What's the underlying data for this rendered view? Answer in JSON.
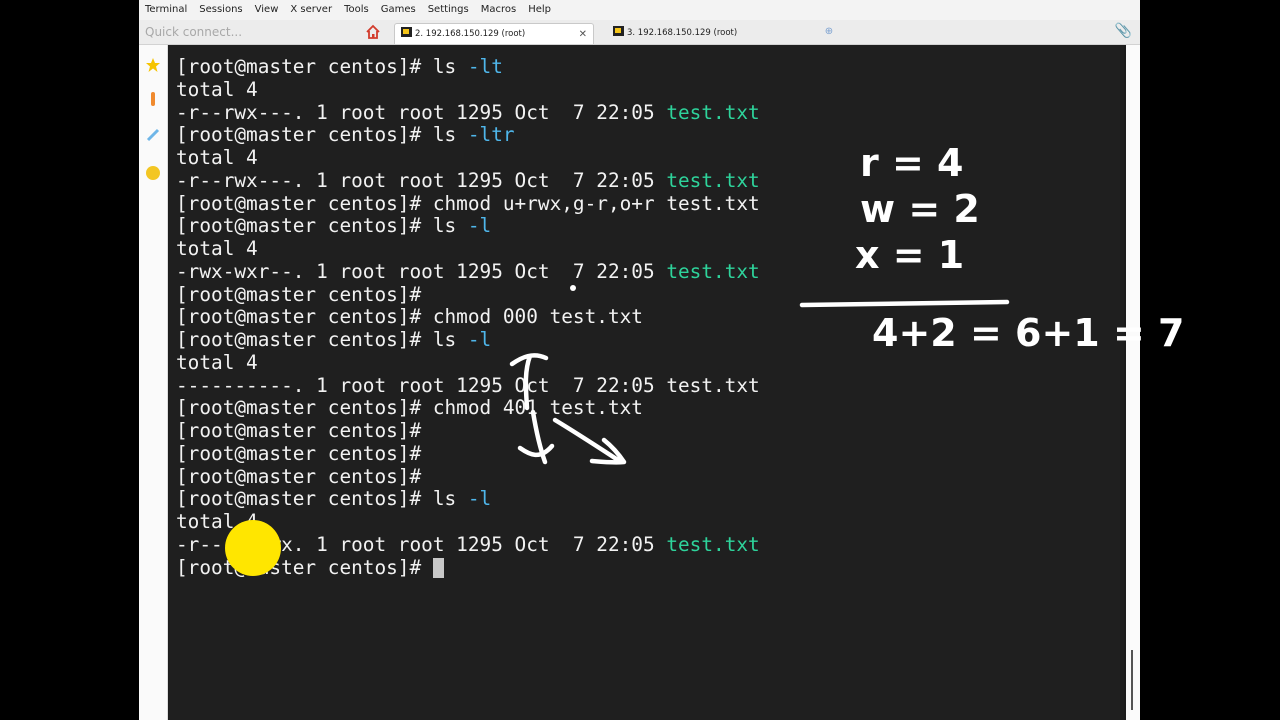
{
  "menu": [
    "Terminal",
    "Sessions",
    "View",
    "X server",
    "Tools",
    "Games",
    "Settings",
    "Macros",
    "Help"
  ],
  "quick_connect": {
    "placeholder": "Quick connect..."
  },
  "tabs": [
    {
      "label": "2. 192.168.150.129 (root)",
      "active": true
    },
    {
      "label": "3. 192.168.150.129 (root)",
      "active": false
    }
  ],
  "terminal": {
    "lines": [
      {
        "segments": [
          {
            "text": "[root@master centos]# ls "
          },
          {
            "text": "-lt",
            "cls": "opt"
          }
        ]
      },
      {
        "segments": [
          {
            "text": "total 4"
          }
        ]
      },
      {
        "segments": [
          {
            "text": "-r--rwx---. 1 root root 1295 Oct  7 22:05 "
          },
          {
            "text": "test.txt",
            "cls": "file"
          }
        ]
      },
      {
        "segments": [
          {
            "text": "[root@master centos]# ls "
          },
          {
            "text": "-ltr",
            "cls": "opt"
          }
        ]
      },
      {
        "segments": [
          {
            "text": "total 4"
          }
        ]
      },
      {
        "segments": [
          {
            "text": "-r--rwx---. 1 root root 1295 Oct  7 22:05 "
          },
          {
            "text": "test.txt",
            "cls": "file"
          }
        ]
      },
      {
        "segments": [
          {
            "text": "[root@master centos]# chmod u+rwx,g-r,o+r test.txt"
          }
        ]
      },
      {
        "segments": [
          {
            "text": "[root@master centos]# ls "
          },
          {
            "text": "-l",
            "cls": "opt"
          }
        ]
      },
      {
        "segments": [
          {
            "text": "total 4"
          }
        ]
      },
      {
        "segments": [
          {
            "text": "-rwx-wxr--. 1 root root 1295 Oct  7 22:05 "
          },
          {
            "text": "test.txt",
            "cls": "file"
          }
        ]
      },
      {
        "segments": [
          {
            "text": "[root@master centos]#"
          }
        ]
      },
      {
        "segments": [
          {
            "text": "[root@master centos]# chmod 000 test.txt"
          }
        ]
      },
      {
        "segments": [
          {
            "text": "[root@master centos]# ls "
          },
          {
            "text": "-l",
            "cls": "opt"
          }
        ]
      },
      {
        "segments": [
          {
            "text": "total 4"
          }
        ]
      },
      {
        "segments": [
          {
            "text": "----------. 1 root root 1295 Oct  7 22:05 test.txt"
          }
        ]
      },
      {
        "segments": [
          {
            "text": "[root@master centos]# chmod 401 test.txt"
          }
        ]
      },
      {
        "segments": [
          {
            "text": "[root@master centos]#"
          }
        ]
      },
      {
        "segments": [
          {
            "text": "[root@master centos]#"
          }
        ]
      },
      {
        "segments": [
          {
            "text": "[root@master centos]#"
          }
        ]
      },
      {
        "segments": [
          {
            "text": "[root@master centos]# ls "
          },
          {
            "text": "-l",
            "cls": "opt"
          }
        ]
      },
      {
        "segments": [
          {
            "text": "total 4"
          }
        ]
      },
      {
        "segments": [
          {
            "text": "-r-----rwx. 1 root root 1295 Oct  7 22:05 "
          },
          {
            "text": "test.txt",
            "cls": "file"
          }
        ]
      },
      {
        "segments": [
          {
            "text": "[root@master centos]# "
          }
        ],
        "cursor": true
      }
    ]
  },
  "annotation": {
    "lines": [
      "r = 4",
      "w = 2",
      "x = 1",
      "4+2 = 6+1 = 7"
    ],
    "color": "#ffffff"
  },
  "highlight_color": "#ffe600",
  "colors": {
    "option": "#4fb6ea",
    "file": "#2ed39b",
    "background": "#1f1f1f",
    "text": "#f2f2f2"
  }
}
